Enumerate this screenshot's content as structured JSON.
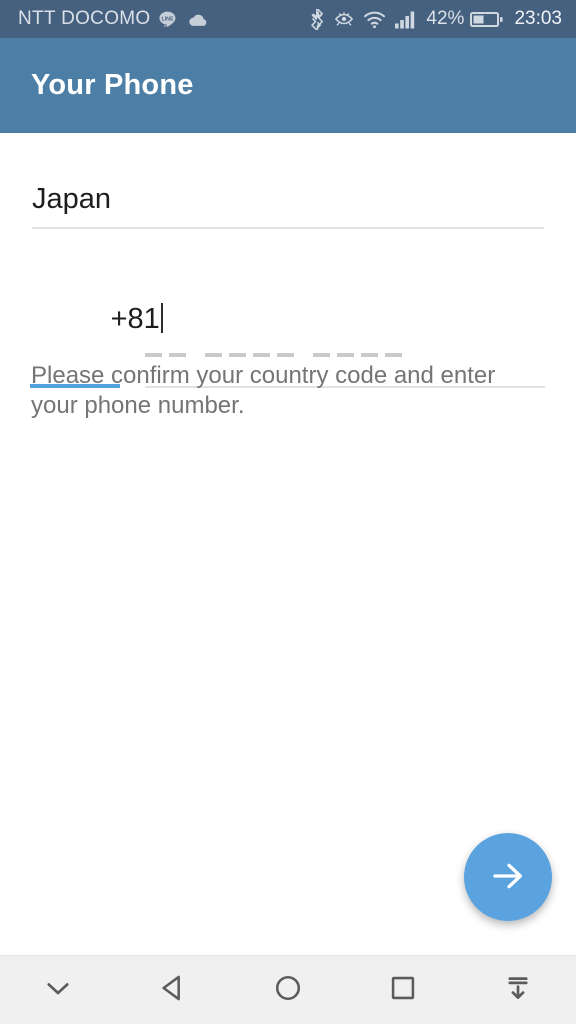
{
  "status_bar": {
    "carrier": "NTT DOCOMO",
    "battery_percent": "42%",
    "clock": "23:03",
    "icons": [
      "line-app-icon",
      "cloud-icon",
      "bluetooth-icon",
      "eye-comfort-icon",
      "wifi-icon",
      "cellular-signal-icon",
      "battery-icon"
    ],
    "background_color": "#46617f",
    "text_color": "#d9e0e8"
  },
  "app_bar": {
    "title": "Your Phone",
    "background_color": "#4d7fa6",
    "title_color": "#ffffff"
  },
  "form": {
    "country_field": {
      "value": "Japan",
      "underline_color": "#e2e2e2"
    },
    "country_code_field": {
      "value": "+81",
      "focused": true,
      "underline_color": "#4ea2de"
    },
    "phone_number_field": {
      "value": "",
      "placeholder": "-- ---- ----",
      "placeholder_groups": [
        2,
        4,
        4
      ],
      "underline_color": "#e2e2e2"
    },
    "helper_text": "Please confirm your country code and enter your phone number.",
    "helper_text_color": "#757575"
  },
  "fab": {
    "icon": "arrow-right-icon",
    "label": "Next",
    "background_color": "#5ba3de",
    "icon_color": "#ffffff"
  },
  "nav_bar": {
    "background_color": "#f0f0f0",
    "icon_color": "#5c5c5c",
    "items": [
      {
        "name": "hide-keyboard-icon",
        "label": "Hide keyboard"
      },
      {
        "name": "back-icon",
        "label": "Back"
      },
      {
        "name": "home-icon",
        "label": "Home"
      },
      {
        "name": "recents-icon",
        "label": "Recents"
      },
      {
        "name": "hide-navbar-icon",
        "label": "Hide navigation bar"
      }
    ]
  }
}
